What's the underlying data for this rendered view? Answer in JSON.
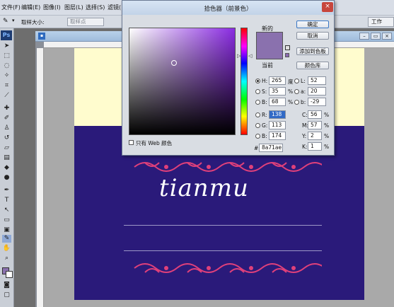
{
  "menubar": {
    "items": [
      "文件(F)",
      "编辑(E)",
      "图像(I)",
      "图层(L)",
      "选择(S)",
      "滤镜("
    ]
  },
  "options": {
    "sample_size_label": "取样大小:",
    "sample_size_value": "取样点"
  },
  "workspace": {
    "label": "工作"
  },
  "tools_logo": "Ps",
  "document": {
    "card_text": "tianmu",
    "card_color": "#2a1a7a",
    "upper_fill_color": "#fffcce"
  },
  "dialog": {
    "title": "拾色器（前景色）",
    "label_new": "新的",
    "label_current": "当前",
    "buttons": {
      "ok": "确定",
      "cancel": "取消",
      "add_swatch": "添加到色板",
      "libraries": "颜色库"
    },
    "hsb": {
      "h_label": "H:",
      "h_value": "265",
      "h_unit": "度",
      "s_label": "S:",
      "s_value": "35",
      "s_unit": "%",
      "b_label": "B:",
      "b_value": "68",
      "b_unit": "%"
    },
    "rgb": {
      "r_label": "R:",
      "r_value": "138",
      "g_label": "G:",
      "g_value": "113",
      "b_label": "B:",
      "b_value": "174"
    },
    "lab": {
      "l_label": "L:",
      "l_value": "52",
      "a_label": "a:",
      "a_value": "20",
      "b_label": "b:",
      "b_value": "-29"
    },
    "cmyk": {
      "c_label": "C:",
      "c_value": "56",
      "c_unit": "%",
      "m_label": "M:",
      "m_value": "57",
      "m_unit": "%",
      "y_label": "Y:",
      "y_value": "2",
      "y_unit": "%",
      "k_label": "K:",
      "k_value": "1",
      "k_unit": "%"
    },
    "hex_label": "#",
    "hex_value": "8a71ae",
    "web_only_label": "只有 Web 颜色",
    "new_color": "#8a71ae",
    "current_color": "#8a71ae"
  }
}
